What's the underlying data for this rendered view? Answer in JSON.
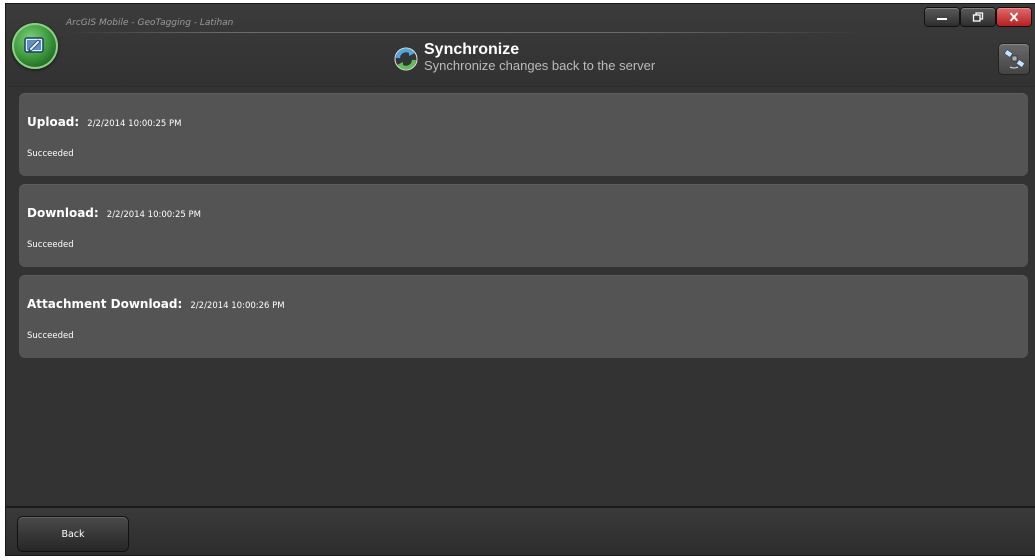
{
  "window": {
    "app_title": "ArcGIS Mobile - GeoTagging - Latihan",
    "controls": {
      "minimize_icon": "minimize-icon",
      "maximize_icon": "restore-icon",
      "close_icon": "close-icon"
    }
  },
  "header": {
    "title": "Synchronize",
    "subtitle": "Synchronize changes back to the server",
    "sync_icon": "sync-arrows-icon",
    "gps_icon": "satellite-icon"
  },
  "sync_results": [
    {
      "label": "Upload:",
      "time": "2/2/2014 10:00:25 PM",
      "status": "Succeeded"
    },
    {
      "label": "Download:",
      "time": "2/2/2014 10:00:25 PM",
      "status": "Succeeded"
    },
    {
      "label": "Attachment Download:",
      "time": "2/2/2014 10:00:26 PM",
      "status": "Succeeded"
    }
  ],
  "footer": {
    "back_label": "Back"
  },
  "colors": {
    "background": "#333333",
    "card": "#545454",
    "close_button": "#c62b2b",
    "logo_green": "#3d9b3d"
  }
}
